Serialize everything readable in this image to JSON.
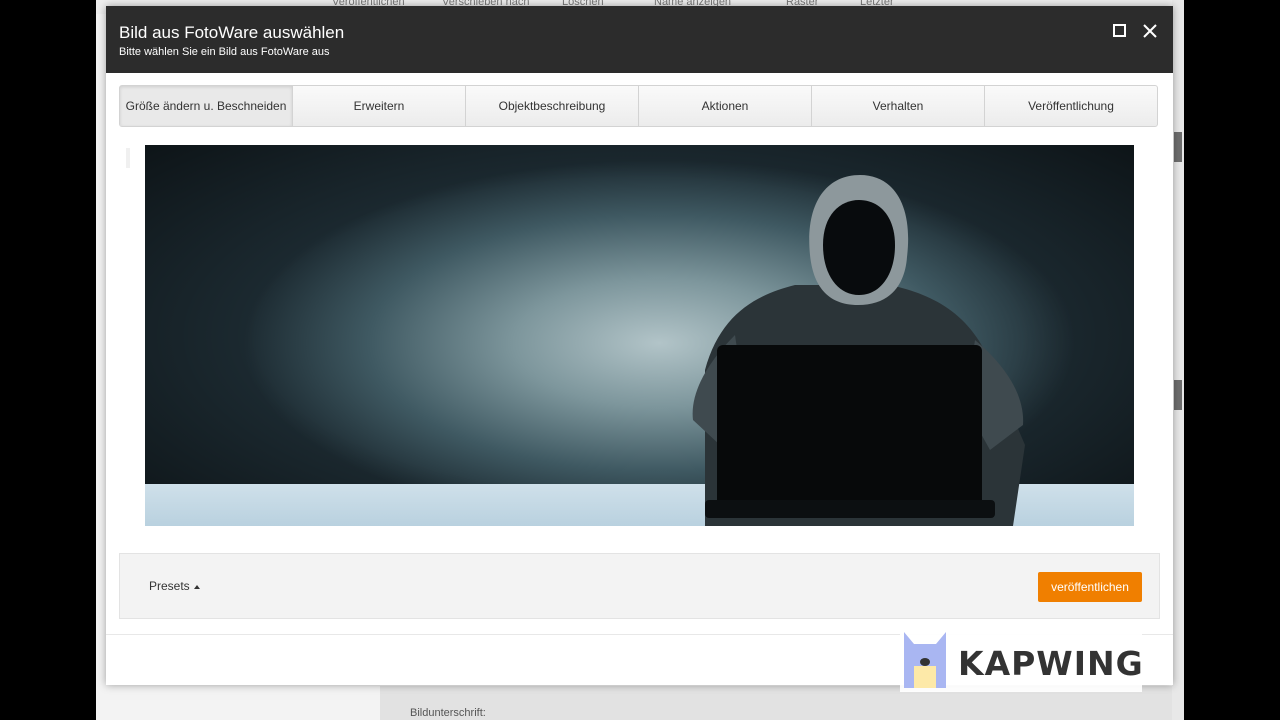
{
  "background": {
    "toolbar_items": [
      "Veröffentlichen",
      "Verschieben nach",
      "Löschen",
      "Name anzeigen",
      "Raster",
      "Letzter"
    ],
    "caption_label": "Bildunterschrift:"
  },
  "dialog": {
    "title": "Bild aus FotoWare auswählen",
    "subtitle": "Bitte wählen Sie ein Bild aus FotoWare aus",
    "maximize_icon": "maximize-icon",
    "close_icon": "close-icon"
  },
  "tabs": [
    {
      "label": "Größe ändern u. Beschneiden",
      "active": true
    },
    {
      "label": "Erweitern",
      "active": false
    },
    {
      "label": "Objektbeschreibung",
      "active": false
    },
    {
      "label": "Aktionen",
      "active": false
    },
    {
      "label": "Verhalten",
      "active": false
    },
    {
      "label": "Veröffentlichung",
      "active": false
    }
  ],
  "image": {
    "subject": "hooded figure with laptop"
  },
  "footer": {
    "presets_label": "Presets",
    "publish_label": "veröffentlichen"
  },
  "watermark": {
    "text": "KAPWING"
  },
  "colors": {
    "header": "#2c2c2c",
    "accent": "#f07f00"
  }
}
